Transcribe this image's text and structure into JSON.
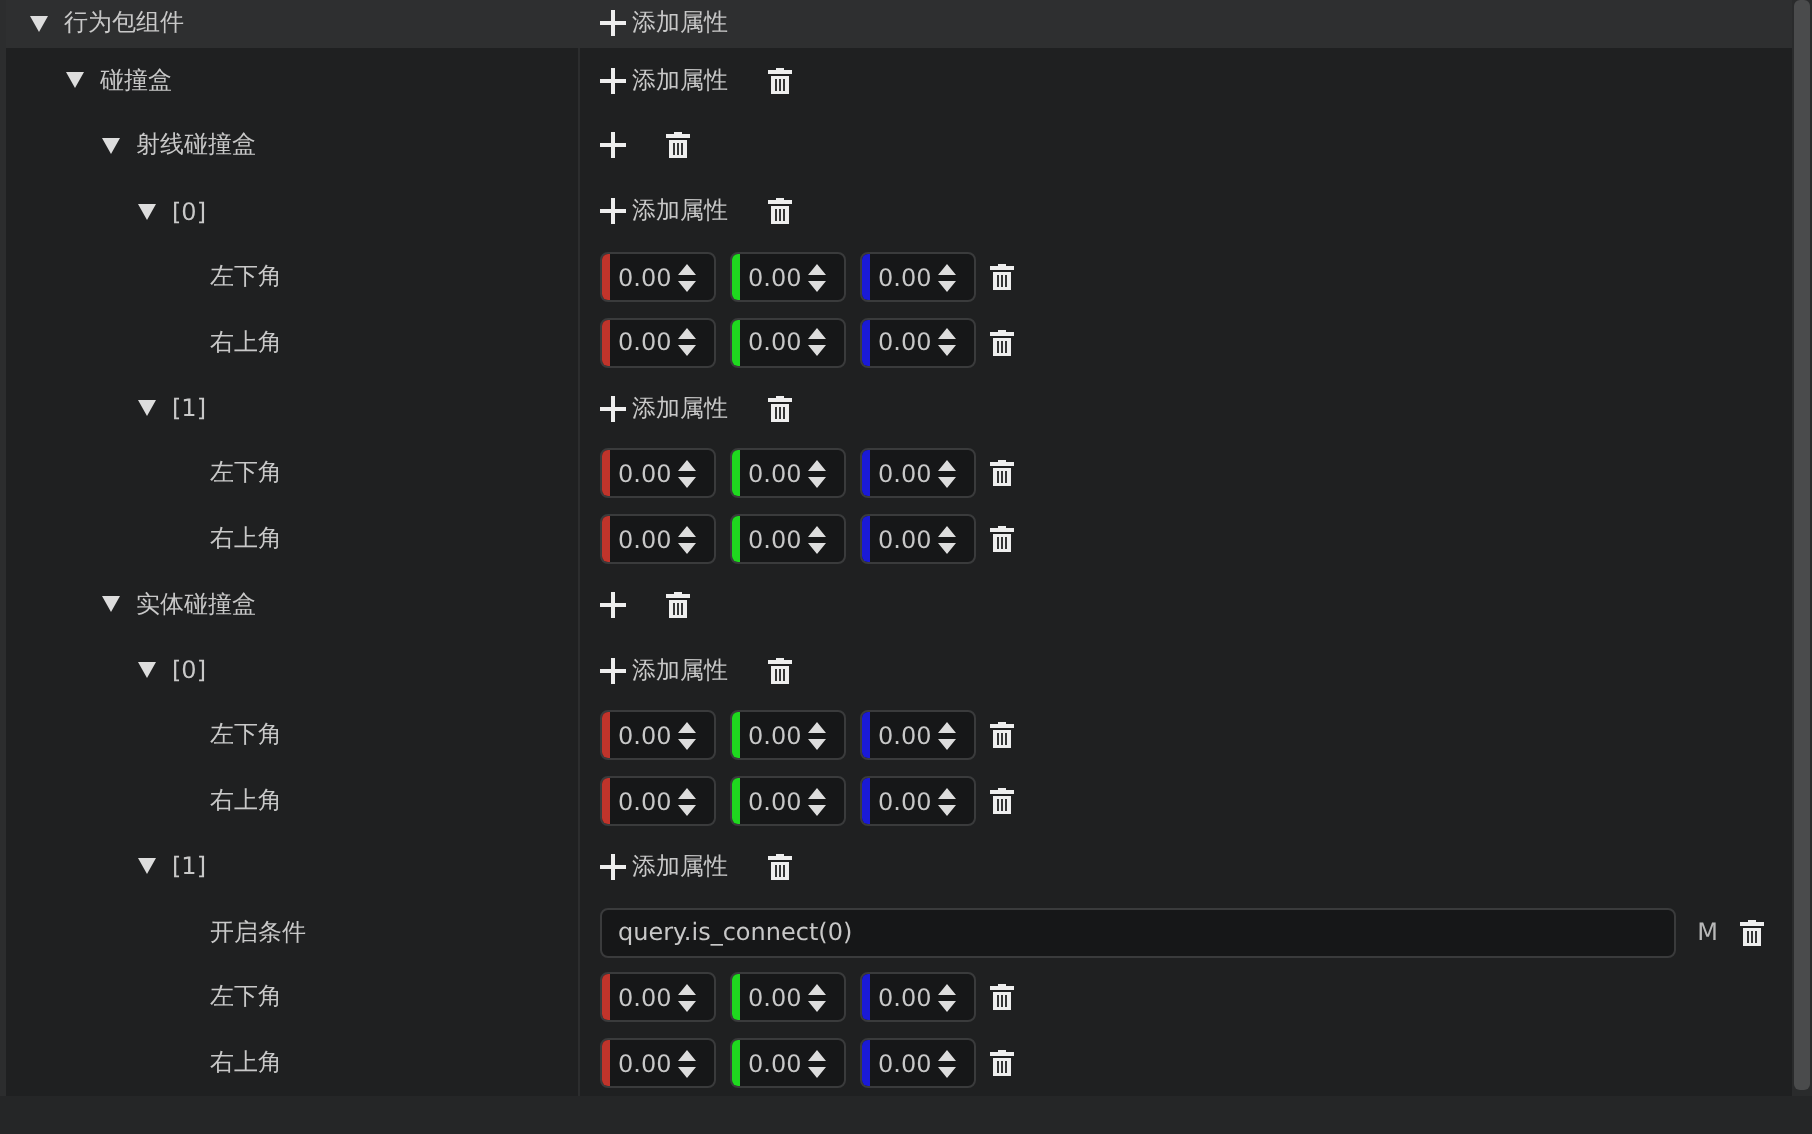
{
  "tree": [
    {
      "kind": "group",
      "label": "行为包组件",
      "expanded": true,
      "add_label": "添加属性",
      "deletable": false,
      "children": [
        {
          "kind": "group",
          "label": "碰撞盒",
          "expanded": true,
          "add_label": "添加属性",
          "deletable": true,
          "children": [
            {
              "kind": "group",
              "label": "射线碰撞盒",
              "expanded": true,
              "deletable": true,
              "children": [
                {
                  "kind": "group",
                  "label": "[0]",
                  "expanded": true,
                  "add_label": "添加属性",
                  "deletable": true,
                  "children": [
                    {
                      "kind": "vector",
                      "label": "左下角",
                      "values": [
                        {
                          "value": "0.00",
                          "color": "#c0342b"
                        },
                        {
                          "value": "0.00",
                          "color": "#1fd81f"
                        },
                        {
                          "value": "0.00",
                          "color": "#1a1ad6"
                        }
                      ]
                    },
                    {
                      "kind": "vector",
                      "label": "右上角",
                      "values": [
                        {
                          "value": "0.00",
                          "color": "#c0342b"
                        },
                        {
                          "value": "0.00",
                          "color": "#1fd81f"
                        },
                        {
                          "value": "0.00",
                          "color": "#1a1ad6"
                        }
                      ]
                    }
                  ]
                },
                {
                  "kind": "group",
                  "label": "[1]",
                  "expanded": true,
                  "add_label": "添加属性",
                  "deletable": true,
                  "children": [
                    {
                      "kind": "vector",
                      "label": "左下角",
                      "values": [
                        {
                          "value": "0.00",
                          "color": "#c0342b"
                        },
                        {
                          "value": "0.00",
                          "color": "#1fd81f"
                        },
                        {
                          "value": "0.00",
                          "color": "#1a1ad6"
                        }
                      ]
                    },
                    {
                      "kind": "vector",
                      "label": "右上角",
                      "values": [
                        {
                          "value": "0.00",
                          "color": "#c0342b"
                        },
                        {
                          "value": "0.00",
                          "color": "#1fd81f"
                        },
                        {
                          "value": "0.00",
                          "color": "#1a1ad6"
                        }
                      ]
                    }
                  ]
                }
              ]
            },
            {
              "kind": "group",
              "label": "实体碰撞盒",
              "expanded": true,
              "deletable": true,
              "children": [
                {
                  "kind": "group",
                  "label": "[0]",
                  "expanded": true,
                  "add_label": "添加属性",
                  "deletable": true,
                  "children": [
                    {
                      "kind": "vector",
                      "label": "左下角",
                      "values": [
                        {
                          "value": "0.00",
                          "color": "#c0342b"
                        },
                        {
                          "value": "0.00",
                          "color": "#1fd81f"
                        },
                        {
                          "value": "0.00",
                          "color": "#1a1ad6"
                        }
                      ]
                    },
                    {
                      "kind": "vector",
                      "label": "右上角",
                      "values": [
                        {
                          "value": "0.00",
                          "color": "#c0342b"
                        },
                        {
                          "value": "0.00",
                          "color": "#1fd81f"
                        },
                        {
                          "value": "0.00",
                          "color": "#1a1ad6"
                        }
                      ]
                    }
                  ]
                },
                {
                  "kind": "group",
                  "label": "[1]",
                  "expanded": true,
                  "add_label": "添加属性",
                  "deletable": true,
                  "children": [
                    {
                      "kind": "text",
                      "label": "开启条件",
                      "value": "query.is_connect(0)",
                      "mode": "M"
                    },
                    {
                      "kind": "vector",
                      "label": "左下角",
                      "values": [
                        {
                          "value": "0.00",
                          "color": "#c0342b"
                        },
                        {
                          "value": "0.00",
                          "color": "#1fd81f"
                        },
                        {
                          "value": "0.00",
                          "color": "#1a1ad6"
                        }
                      ]
                    },
                    {
                      "kind": "vector",
                      "label": "右上角",
                      "values": [
                        {
                          "value": "0.00",
                          "color": "#c0342b"
                        },
                        {
                          "value": "0.00",
                          "color": "#1fd81f"
                        },
                        {
                          "value": "0.00",
                          "color": "#1a1ad6"
                        }
                      ]
                    }
                  ]
                }
              ]
            }
          ]
        }
      ]
    }
  ]
}
